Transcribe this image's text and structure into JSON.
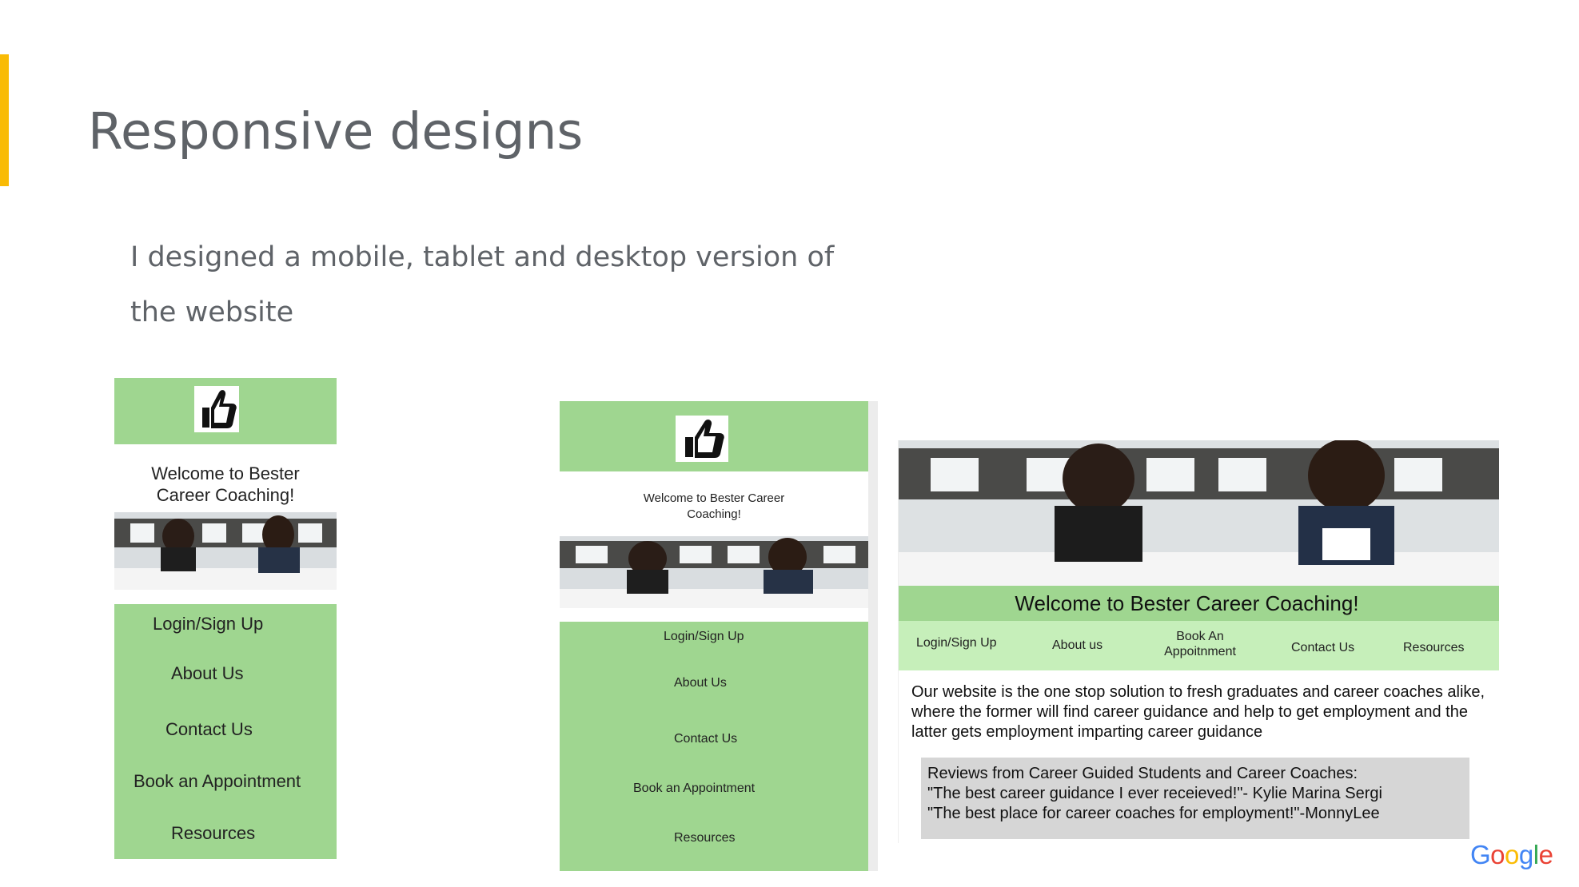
{
  "slide": {
    "title": "Responsive designs",
    "body": "I designed a mobile, tablet and desktop version of the website"
  },
  "colors": {
    "accent": "#f9bb05",
    "mock_green": "#9fd690",
    "mock_light_green": "#c6efba",
    "review_gray": "#d6d6d6"
  },
  "icons": {
    "logo": "thumbs-up-icon"
  },
  "mobile": {
    "welcome": "Welcome to Bester Career Coaching!",
    "nav": [
      "Login/Sign Up",
      "About Us",
      "Contact Us",
      "Book an Appointment",
      "Resources"
    ]
  },
  "tablet": {
    "welcome": "Welcome to Bester Career Coaching!",
    "nav": [
      "Login/Sign Up",
      "About Us",
      "Contact Us",
      "Book an Appointment",
      "Resources"
    ]
  },
  "desktop": {
    "welcome": "Welcome to Bester Career Coaching!",
    "nav": [
      "Login/Sign Up",
      "About us",
      "Book An Appoitnment",
      "Contact Us",
      "Resources"
    ],
    "about": "Our website is the one stop solution to fresh graduates and career coaches alike, where the former will find career guidance and help to get employment and the latter gets employment imparting career guidance",
    "reviews_title": "Reviews from Career Guided Students and Career Coaches:",
    "reviews": [
      "\"The best career guidance I ever receieved!\"- Kylie Marina Sergi",
      "\"The best place for career coaches for employment!\"-MonnyLee"
    ]
  },
  "footer": {
    "logo_text": "Google"
  }
}
